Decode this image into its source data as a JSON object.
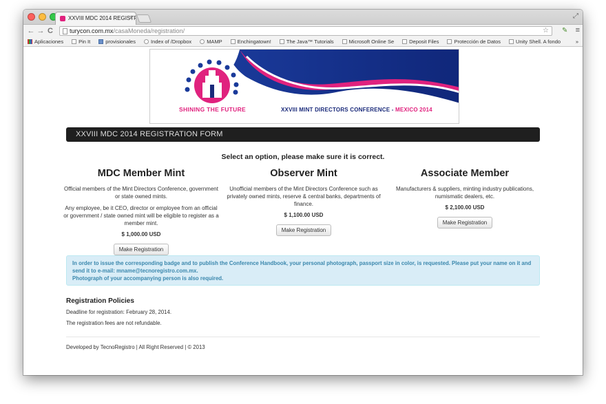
{
  "browser": {
    "tab_title": "XXVIII MDC 2014 REGISTRA",
    "tab_close": "×",
    "url_host": "turycon.com.mx",
    "url_path": "/casaMoneda/registration/",
    "nav": {
      "back": "←",
      "forward": "→",
      "reload": "C"
    },
    "star": "☆",
    "menu": "≡",
    "resize": "⤢"
  },
  "bookmarks": [
    {
      "label": "Aplicaciones",
      "icon": "apps-icon"
    },
    {
      "label": "Pin It",
      "icon": "page-icon"
    },
    {
      "label": "provisionales",
      "icon": "folder-icon"
    },
    {
      "label": "Index of /Dropbox",
      "icon": "cloud-icon"
    },
    {
      "label": "MAMP",
      "icon": "cloud-icon"
    },
    {
      "label": "Enchingatown!",
      "icon": "page-icon"
    },
    {
      "label": "The Java™ Tutorials",
      "icon": "page-icon"
    },
    {
      "label": "Microsoft Online Se",
      "icon": "page-icon"
    },
    {
      "label": "Deposit Files",
      "icon": "page-icon"
    },
    {
      "label": "Protección de Datos",
      "icon": "page-icon"
    },
    {
      "label": "Unity Shell. A fondo",
      "icon": "page-icon"
    }
  ],
  "bookmarks_more": "»",
  "banner": {
    "left_text": "SHINING THE FUTURE",
    "right_text": "XXVIII MINT DIRECTORS CONFERENCE - ",
    "right_highlight": "MEXICO 2014"
  },
  "header": {
    "title": "XXVIII MDC 2014 REGISTRATION FORM"
  },
  "prompt": "Select an option, please make sure it is correct.",
  "options": [
    {
      "title": "MDC Member Mint",
      "paragraphs": [
        "Official members of the Mint Directors Conference, government or state owned mints.",
        "Any employee, be it CEO, director or employee from an official or government / state owned mint will be eligible to register as a member mint."
      ],
      "price": "$ 1,000.00 USD",
      "button": "Make Registration"
    },
    {
      "title": "Observer Mint",
      "paragraphs": [
        "Unofficial members of the Mint Directors Conference such as privately owned mints, reserve & central banks, departments of finance."
      ],
      "price": "$ 1,100.00 USD",
      "button": "Make Registration"
    },
    {
      "title": "Associate Member",
      "paragraphs": [
        "Manufacturers & suppliers, minting industry publications, numismatic dealers, etc."
      ],
      "price": "$ 2,100.00 USD",
      "button": "Make Registration"
    }
  ],
  "notice": {
    "line1": "In order to issue the corresponding badge and to publish the Conference Handbook, your personal photograph, passport size in color, is requested. Please put your name on it and send it to e-mail: mname@tecnoregistro.com.mx.",
    "line2": "Photograph of your accompanying person is also required."
  },
  "policies": {
    "title": "Registration Policies",
    "deadline": "Deadline for registration: February 28, 2014.",
    "refund": "The registration fees are not refundable."
  },
  "footer": "Developed by TecnoRegistro | All Right Reserved | © 2013",
  "colors": {
    "brand_pink": "#e0227e",
    "brand_blue": "#1a2a7a",
    "header_bg": "#1f1f1f",
    "alert_bg": "#d9edf7",
    "alert_text": "#3a87ad"
  }
}
